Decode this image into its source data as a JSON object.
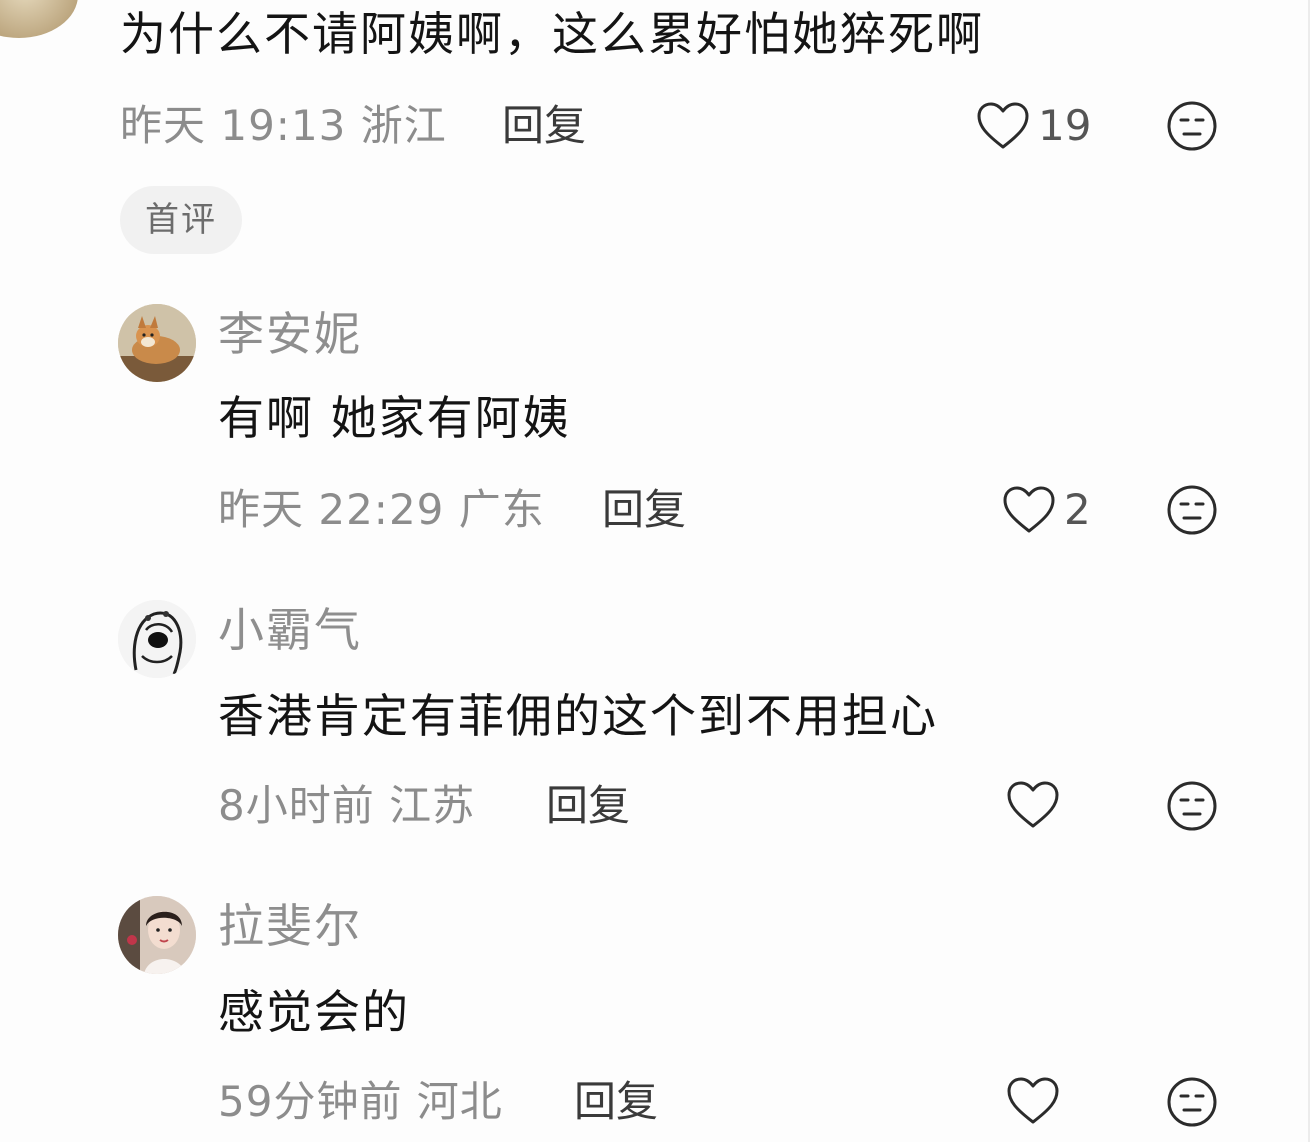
{
  "main_comment": {
    "text": "为什么不请阿姨啊，这么累好怕她猝死啊",
    "meta": "昨天 19:13 浙江",
    "reply_label": "回复",
    "like_count": "19",
    "badge": "首评"
  },
  "replies": [
    {
      "username": "李安妮",
      "text": "有啊 她家有阿姨",
      "meta": "昨天 22:29 广东",
      "reply_label": "回复",
      "like_count": "2",
      "avatar": "shiba-dog-avatar"
    },
    {
      "username": "小霸气",
      "text": "香港肯定有菲佣的这个到不用担心",
      "meta": "8小时前 江苏",
      "reply_label": "回复",
      "like_count": "",
      "avatar": "sketch-portrait-avatar"
    },
    {
      "username": "拉斐尔",
      "text": "感觉会的",
      "meta": "59分钟前 河北",
      "reply_label": "回复",
      "like_count": "",
      "avatar": "woman-portrait-avatar"
    }
  ],
  "icons": {
    "like": "heart-outline-icon",
    "emoji": "neutral-face-icon"
  },
  "colors": {
    "background": "#fdfdfd",
    "text": "#141414",
    "meta": "#8c8c8c",
    "badge_bg": "#f1f1f1"
  }
}
